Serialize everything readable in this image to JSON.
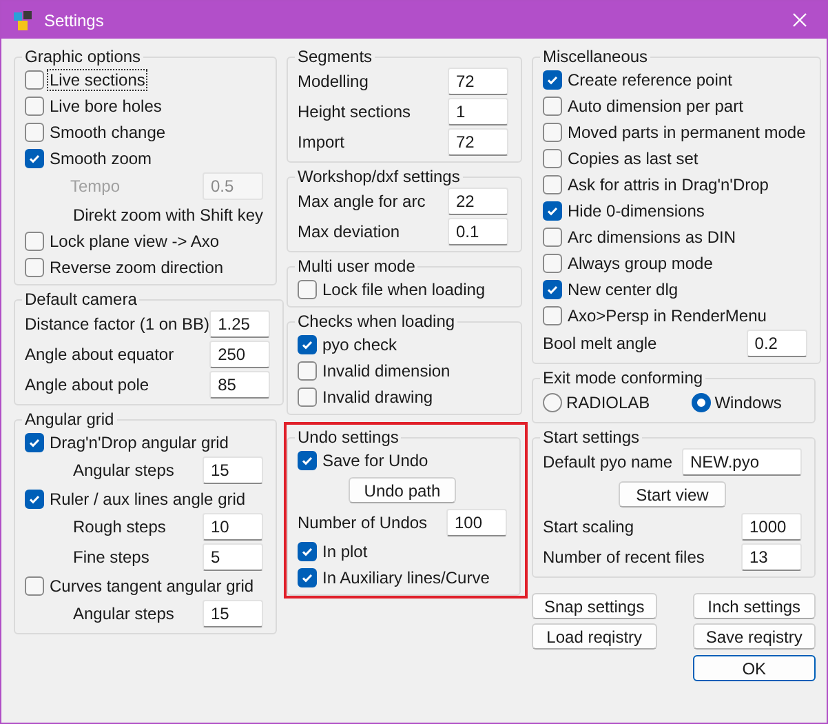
{
  "window": {
    "title": "Settings"
  },
  "columns": [
    {
      "groups": [
        {
          "title": "Graphic options",
          "items": [
            {
              "kind": "check",
              "label": "Live sections",
              "checked": false,
              "focused": true
            },
            {
              "kind": "check",
              "label": "Live bore holes",
              "checked": false
            },
            {
              "kind": "check",
              "label": "Smooth change",
              "checked": false
            },
            {
              "kind": "check",
              "label": "Smooth zoom",
              "checked": true,
              "children": [
                {
                  "kind": "field",
                  "label": "Tempo",
                  "value": "0.5",
                  "disabled": true
                },
                {
                  "kind": "note",
                  "text": "Direkt zoom with Shift key"
                }
              ]
            },
            {
              "kind": "check",
              "label": "Lock plane view -> Axo",
              "checked": false
            },
            {
              "kind": "check",
              "label": "Reverse zoom direction",
              "checked": false
            }
          ]
        },
        {
          "title": "Default camera",
          "items": [
            {
              "kind": "field",
              "label": "Distance factor (1 on BB)",
              "value": "1.25"
            },
            {
              "kind": "field",
              "label": "Angle about equator",
              "value": "250"
            },
            {
              "kind": "field",
              "label": "Angle about pole",
              "value": "85"
            }
          ]
        },
        {
          "title": "Angular grid",
          "items": [
            {
              "kind": "check",
              "label": "Drag'n'Drop angular grid",
              "checked": true,
              "children": [
                {
                  "kind": "field",
                  "label": "Angular steps",
                  "value": "15"
                }
              ]
            },
            {
              "kind": "check",
              "label": "Ruler / aux lines angle grid",
              "checked": true,
              "children": [
                {
                  "kind": "field",
                  "label": "Rough steps",
                  "value": "10"
                },
                {
                  "kind": "field",
                  "label": "Fine steps",
                  "value": "5"
                }
              ]
            },
            {
              "kind": "check",
              "label": "Curves tangent angular grid",
              "checked": false,
              "children": [
                {
                  "kind": "field",
                  "label": "Angular steps",
                  "value": "15"
                }
              ]
            }
          ]
        }
      ]
    },
    {
      "groups": [
        {
          "title": "Segments",
          "items": [
            {
              "kind": "field",
              "label": "Modelling",
              "value": "72"
            },
            {
              "kind": "field",
              "label": "Height sections",
              "value": "1"
            },
            {
              "kind": "field",
              "label": "Import",
              "value": "72"
            }
          ]
        },
        {
          "title": "Workshop/dxf settings",
          "items": [
            {
              "kind": "field",
              "label": "Max angle for arc",
              "value": "22"
            },
            {
              "kind": "field",
              "label": "Max deviation",
              "value": "0.1"
            }
          ]
        },
        {
          "title": "Multi user mode",
          "items": [
            {
              "kind": "check",
              "label": "Lock file when loading",
              "checked": false
            }
          ]
        },
        {
          "title": "Checks when loading",
          "items": [
            {
              "kind": "check",
              "label": "pyo check",
              "checked": true
            },
            {
              "kind": "check",
              "label": "Invalid dimension",
              "checked": false
            },
            {
              "kind": "check",
              "label": "Invalid drawing",
              "checked": false
            }
          ]
        },
        {
          "title": "Undo settings",
          "highlighted": true,
          "items": [
            {
              "kind": "check",
              "label": "Save for Undo",
              "checked": true
            },
            {
              "kind": "button",
              "label": "Undo path"
            },
            {
              "kind": "field",
              "label": "Number of Undos",
              "value": "100"
            },
            {
              "kind": "check",
              "label": "In plot",
              "checked": true
            },
            {
              "kind": "check",
              "label": "In Auxiliary lines/Curve",
              "checked": true
            }
          ]
        }
      ]
    },
    {
      "groups": [
        {
          "title": "Miscellaneous",
          "items": [
            {
              "kind": "check",
              "label": "Create reference point",
              "checked": true
            },
            {
              "kind": "check",
              "label": "Auto dimension per part",
              "checked": false
            },
            {
              "kind": "check",
              "label": "Moved parts in permanent mode",
              "checked": false
            },
            {
              "kind": "check",
              "label": "Copies as last set",
              "checked": false
            },
            {
              "kind": "check",
              "label": "Ask for attris in Drag'n'Drop",
              "checked": false
            },
            {
              "kind": "check",
              "label": "Hide 0-dimensions",
              "checked": true
            },
            {
              "kind": "check",
              "label": "Arc dimensions as DIN",
              "checked": false
            },
            {
              "kind": "check",
              "label": "Always group mode",
              "checked": false
            },
            {
              "kind": "check",
              "label": "New center dlg",
              "checked": true
            },
            {
              "kind": "check",
              "label": "Axo>Persp in RenderMenu",
              "checked": false
            },
            {
              "kind": "field",
              "label": "Bool melt angle",
              "value": "0.2"
            }
          ]
        },
        {
          "title": "Exit mode conforming",
          "items": [
            {
              "kind": "radios",
              "options": [
                {
                  "label": "RADIOLAB",
                  "selected": false
                },
                {
                  "label": "Windows",
                  "selected": true
                }
              ]
            }
          ]
        },
        {
          "title": "Start settings",
          "items": [
            {
              "kind": "field",
              "label": "Default pyo name",
              "value": "NEW.pyo"
            },
            {
              "kind": "button",
              "label": "Start view"
            },
            {
              "kind": "field",
              "label": "Start scaling",
              "value": "1000"
            },
            {
              "kind": "field",
              "label": "Number of recent files",
              "value": "13"
            }
          ]
        }
      ],
      "buttons": [
        {
          "label": "Snap settings",
          "default": false
        },
        {
          "label": "Inch settings",
          "default": false
        },
        {
          "label": "Load reqistry",
          "default": false
        },
        {
          "label": "Save reqistry",
          "default": false
        },
        {
          "label": "OK",
          "default": true
        }
      ]
    }
  ]
}
